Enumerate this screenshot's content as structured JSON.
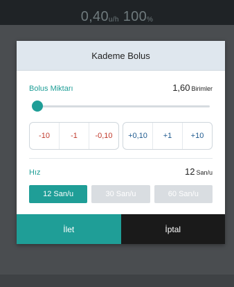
{
  "background": {
    "status": {
      "rate_value": "0,40",
      "rate_unit": "u/h",
      "battery_value": "100",
      "battery_unit": "%"
    }
  },
  "modal": {
    "title": "Kademe Bolus",
    "bolus": {
      "label": "Bolus Miktarı",
      "value": "1,60",
      "unit": "Birimler",
      "slider_fraction": 0.0
    },
    "decrements": [
      "-10",
      "-1",
      "-0,10"
    ],
    "increments": [
      "+0,10",
      "+1",
      "+10"
    ],
    "speed": {
      "label": "Hız",
      "value": "12",
      "unit": "San/u",
      "options": [
        {
          "label": "12 San/u",
          "selected": true
        },
        {
          "label": "30 San/u",
          "selected": false
        },
        {
          "label": "60 San/u",
          "selected": false
        }
      ]
    },
    "buttons": {
      "next": "İlet",
      "cancel": "İptal"
    }
  },
  "colors": {
    "accent": "#1f9e97",
    "negative": "#c0392b",
    "positive": "#1e5a8f",
    "dark": "#1a1a1a",
    "header_bg": "#dfe7ee"
  }
}
